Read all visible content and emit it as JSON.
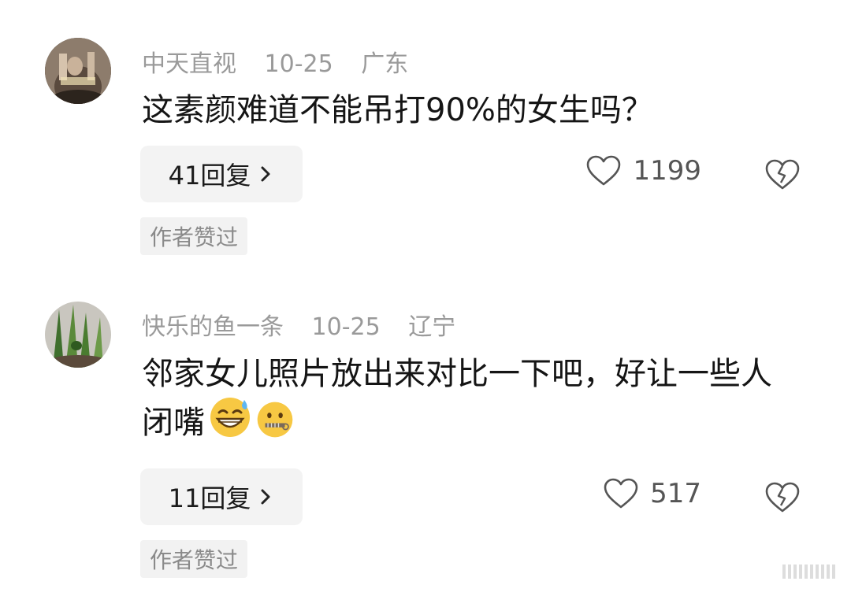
{
  "comments": [
    {
      "username": "中天直视",
      "date": "10-25",
      "location": "广东",
      "text": "这素颜难道不能吊打90%的女生吗？",
      "reply_label": "41回复",
      "likes": "1199",
      "author_liked_label": "作者赞过",
      "icons": [
        "avatar-photo",
        "chevron-right-icon",
        "heart-icon",
        "broken-heart-icon"
      ]
    },
    {
      "username": "快乐的鱼一条",
      "date": "10-25",
      "location": "辽宁",
      "text": "邻家女儿照片放出来对比一下吧，好让一些人闭嘴",
      "emojis": [
        "grinning-sweat-emoji",
        "zipper-mouth-emoji"
      ],
      "reply_label": "11回复",
      "likes": "517",
      "author_liked_label": "作者赞过",
      "icons": [
        "avatar-photo",
        "chevron-right-icon",
        "heart-icon",
        "broken-heart-icon"
      ]
    }
  ],
  "colors": {
    "meta": "#9a9a9a",
    "button_bg": "#f3f3f3",
    "text": "#151515"
  }
}
